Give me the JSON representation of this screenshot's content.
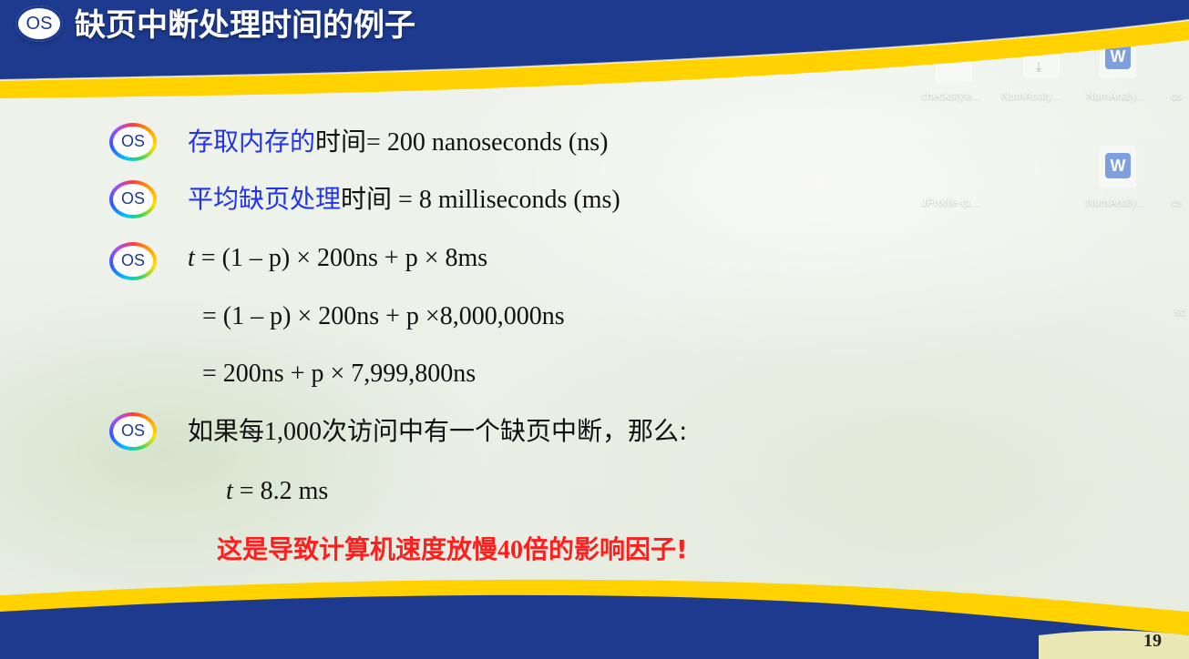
{
  "header": {
    "logo_text": "OS",
    "title": "缺页中断处理时间的例子"
  },
  "bullets": {
    "icon_text": "OS"
  },
  "content": {
    "line1": {
      "zh": "存取内存的",
      "zh_black": "时间",
      "rest": "= 200 nanoseconds (ns)"
    },
    "line2": {
      "zh": "平均缺页处理",
      "zh_black": "时间",
      "rest": " = 8 milliseconds (ms)"
    },
    "line3": {
      "t": "t",
      "rest": " = (1 – p) × 200ns + p × 8ms"
    },
    "line4": {
      "text": "= (1 – p) × 200ns + p ×8,000,000ns"
    },
    "line5": {
      "text": "= 200ns + p × 7,999,800ns"
    },
    "line6": {
      "zh_pre": "如果每",
      "num": "1,000",
      "zh_post": "次访问中有一个缺页中断，那么:"
    },
    "line7": {
      "t": "t",
      "rest": " = 8.2 ms"
    },
    "line8": {
      "zh_pre": "这是导致计算机速度放慢",
      "num": "40",
      "zh_post": "倍的影响因子!"
    }
  },
  "footer": {
    "page_number": "19"
  },
  "desktop": {
    "labels": [
      "checkstyle...",
      "NumAnaly...",
      "NumAnaly...",
      "cs",
      "JProfile-ip...",
      "NumAnaly...",
      "cs",
      "sc"
    ]
  },
  "colors": {
    "header_blue": "#1d3a8f",
    "accent_yellow": "#ffd200",
    "zh_blue": "#2233ee",
    "red": "#ff1e1e"
  }
}
